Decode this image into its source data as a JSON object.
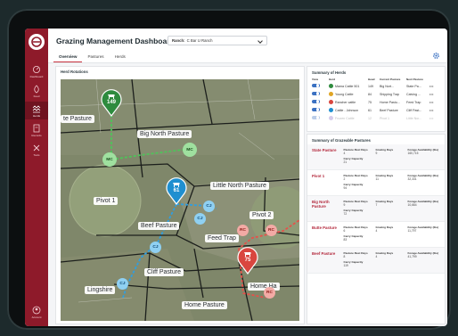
{
  "header": {
    "title": "Grazing Management Dashboard",
    "ranch_label": "Ranch:",
    "ranch_value": "C Bar U Ranch"
  },
  "tabs": [
    "Overview",
    "Pastures",
    "Herds"
  ],
  "sidebar": {
    "items": [
      {
        "label": "Dashboard",
        "icon": "dashboard-icon"
      },
      {
        "label": "Feed",
        "icon": "feed-icon"
      },
      {
        "label": "Herds",
        "icon": "herds-icon",
        "active": true
      },
      {
        "label": "Records",
        "icon": "records-icon"
      },
      {
        "label": "Tools",
        "icon": "tools-icon"
      }
    ],
    "account_label": "Account"
  },
  "map": {
    "title": "Herd Rotations",
    "pasture_labels": [
      "te Pasture",
      "Big North Pasture",
      "Little North Pasture",
      "Pivot 1",
      "Pivot 2",
      "Beef Pasture",
      "Feed Trap",
      "Cliff Pasture",
      "Lingshire",
      "Home Pasture",
      "Home Ha"
    ],
    "pins": [
      {
        "value": "149",
        "color": "#2e8b3e"
      },
      {
        "value": "61",
        "color": "#1f8fd0"
      },
      {
        "value": "75",
        "color": "#d9463f"
      }
    ],
    "markers": [
      "MC",
      "MC",
      "MC",
      "CJ",
      "CJ",
      "CJ",
      "CJ",
      "RC",
      "RC",
      "RC"
    ]
  },
  "herds": {
    "title": "Summary of Herds",
    "columns": [
      "View",
      "Herd",
      "Head",
      "Current Pasture",
      "Next Pasture"
    ],
    "rows": [
      {
        "herd": "Mama Cattle 501",
        "head": "149",
        "current": "Big Nort...",
        "next": "State Pa...",
        "color": "#2e8b3e"
      },
      {
        "herd": "Young Cattle",
        "head": "84",
        "current": "Shipping Trap",
        "next": "Calving ...",
        "color": "#e0a524"
      },
      {
        "herd": "Rancher cattle",
        "head": "75",
        "current": "Home Pastu...",
        "next": "Feed Trap",
        "color": "#d9463f"
      },
      {
        "herd": "Cattle - Johnson",
        "head": "61",
        "current": "Beef Pasture",
        "next": "Cliff Past...",
        "color": "#1f8fd0"
      },
      {
        "herd": "Frozen Cattle",
        "head": "12",
        "current": "Pivot 1",
        "next": "Little Nor...",
        "color": "#8a6fc7"
      }
    ],
    "more": "•••"
  },
  "pastures": {
    "title": "Summary of Grazeable Pastures",
    "rest_label": "Pasture Rest Days",
    "grazing_label": "Grazing Days",
    "forage_label": "Forage Availability (lbs)",
    "carry_label": "Carry Capacity",
    "rows": [
      {
        "name": "State Pasture",
        "rest": "4",
        "grazing": "9",
        "forage": "160,715",
        "carry": "21"
      },
      {
        "name": "Pivot 1",
        "rest": "2",
        "grazing": "11",
        "forage": "32,331",
        "carry": "94"
      },
      {
        "name": "Big North Pasture",
        "rest": "9",
        "grazing": "7",
        "forage": "10,664",
        "carry": "72"
      },
      {
        "name": "Butte Pasture",
        "rest": "6",
        "grazing": "4",
        "forage": "11,797",
        "carry": "83"
      },
      {
        "name": "Beef Pasture",
        "rest": "8",
        "grazing": "4",
        "forage": "41,799",
        "carry": "119"
      }
    ]
  }
}
